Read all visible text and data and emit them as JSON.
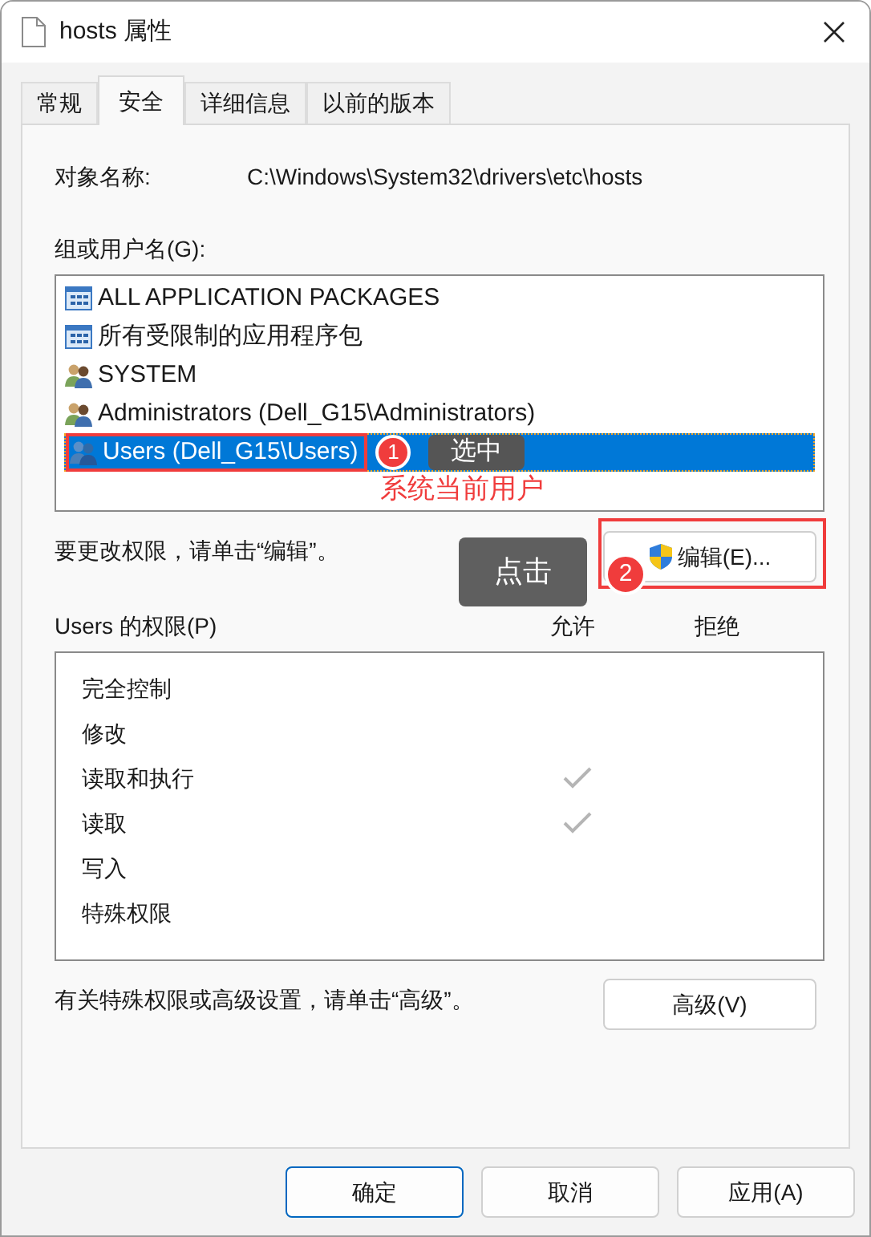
{
  "window": {
    "title": "hosts 属性"
  },
  "tabs": [
    {
      "label": "常规",
      "selected": false
    },
    {
      "label": "安全",
      "selected": true
    },
    {
      "label": "详细信息",
      "selected": false
    },
    {
      "label": "以前的版本",
      "selected": false
    }
  ],
  "object_name": {
    "label": "对象名称:",
    "value": "C:\\Windows\\System32\\drivers\\etc\\hosts"
  },
  "groups": {
    "label": "组或用户名(G):",
    "items": [
      {
        "name": "ALL APPLICATION PACKAGES",
        "kind": "package",
        "selected": false
      },
      {
        "name": "所有受限制的应用程序包",
        "kind": "package",
        "selected": false
      },
      {
        "name": "SYSTEM",
        "kind": "group",
        "selected": false
      },
      {
        "name": "Administrators (Dell_G15\\Administrators)",
        "kind": "group",
        "selected": false
      },
      {
        "name": "Users (Dell_G15\\Users)",
        "kind": "users",
        "selected": true
      }
    ]
  },
  "edit_hint": "要更改权限，请单击“编辑”。",
  "edit_button": "编辑(E)...",
  "permissions": {
    "label": "Users 的权限(P)",
    "allow_header": "允许",
    "deny_header": "拒绝",
    "rows": [
      {
        "name": "完全控制",
        "allow": false,
        "deny": false
      },
      {
        "name": "修改",
        "allow": false,
        "deny": false
      },
      {
        "name": "读取和执行",
        "allow": true,
        "deny": false
      },
      {
        "name": "读取",
        "allow": true,
        "deny": false
      },
      {
        "name": "写入",
        "allow": false,
        "deny": false
      },
      {
        "name": "特殊权限",
        "allow": false,
        "deny": false
      }
    ]
  },
  "advanced_hint": "有关特殊权限或高级设置，请单击“高级”。",
  "advanced_button": "高级(V)",
  "buttons": [
    {
      "label": "确定",
      "default": true
    },
    {
      "label": "取消",
      "default": false
    },
    {
      "label": "应用(A)",
      "default": false
    }
  ],
  "annotations": {
    "select_badge": "1",
    "select_callout": "选中",
    "select_note": "系统当前用户",
    "edit_badge": "2",
    "edit_callout": "点击"
  }
}
